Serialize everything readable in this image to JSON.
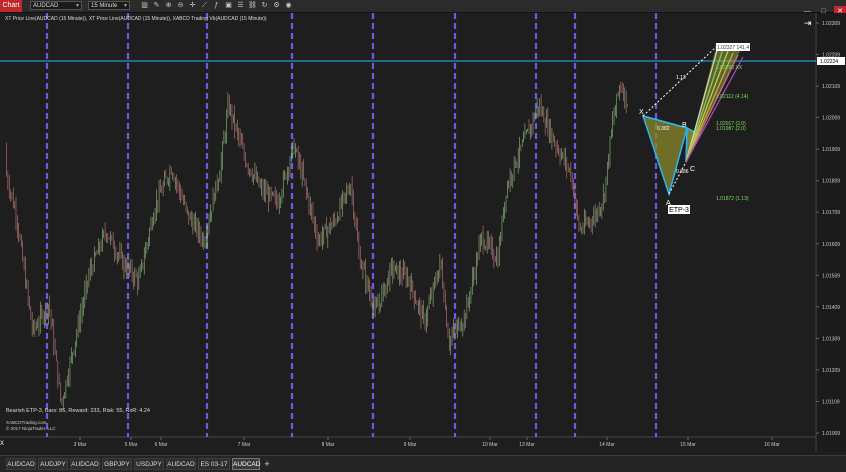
{
  "toolbar": {
    "chart_label": "Chart",
    "instrument": "AUDCAD",
    "interval": "15 Minute"
  },
  "indicator_line": "XT Price Line(AUDCAD (15 Minute)), XT Price Line(AUDCAD (15 Minute)), XABCD Trading Vb(AUDCAD (15 Minute))",
  "stats_line": "Bearish ETP-3, Bars: 86, Reward: 233, Risk: 55, RxR: 4.24",
  "site": "XABCDTrading.com",
  "copyright": "© 2017 NinjaTrader, LLC",
  "close_panel": "X",
  "pattern_labels": {
    "x": "X",
    "a": "A",
    "b": "B",
    "c": "C",
    "name": "ETP-3",
    "target_top": "1.02327 141.4",
    "lvl1": "1.02250 XX",
    "lvl2": "1.02112 (4.14)",
    "lvl3": "1.02017 (2.0)",
    "lvl4": "1.01987 (2.0)",
    "lvl5": "1.01872 (1.13)",
    "ratio1": "1.13",
    "ratio2": "0.382",
    "ratio3": "0.886"
  },
  "chart_data": {
    "type": "candlestick",
    "y_ticks": [
      "1.02309",
      "1.02209",
      "1.02109",
      "1.02009",
      "1.01909",
      "1.01809",
      "1.01709",
      "1.01609",
      "1.01509",
      "1.01409",
      "1.01309",
      "1.01209",
      "1.01109",
      "1.01009"
    ],
    "ylim": [
      1.01009,
      1.02309
    ],
    "current_price": "1.02224",
    "x_ticks": [
      "3 Mar",
      "5 Mar",
      "6 Mar",
      "7 Mar",
      "8 Mar",
      "9 Mar",
      "10 Mar",
      "13 Mar",
      "14 Mar",
      "15 Mar",
      "16 Mar"
    ],
    "session_separator_count": 18,
    "trend_path": [
      [
        0.0,
        1.0191
      ],
      [
        0.02,
        1.017
      ],
      [
        0.04,
        1.0133
      ],
      [
        0.06,
        1.0142
      ],
      [
        0.075,
        1.011
      ],
      [
        0.09,
        1.0128
      ],
      [
        0.11,
        1.0152
      ],
      [
        0.13,
        1.0165
      ],
      [
        0.15,
        1.0155
      ],
      [
        0.17,
        1.0149
      ],
      [
        0.19,
        1.0173
      ],
      [
        0.21,
        1.0185
      ],
      [
        0.23,
        1.017
      ],
      [
        0.25,
        1.0162
      ],
      [
        0.27,
        1.0185
      ],
      [
        0.28,
        1.0205
      ],
      [
        0.3,
        1.0188
      ],
      [
        0.32,
        1.0178
      ],
      [
        0.34,
        1.0174
      ],
      [
        0.36,
        1.0192
      ],
      [
        0.37,
        1.0183
      ],
      [
        0.39,
        1.0162
      ],
      [
        0.41,
        1.0168
      ],
      [
        0.43,
        1.018
      ],
      [
        0.44,
        1.0157
      ],
      [
        0.46,
        1.0139
      ],
      [
        0.48,
        1.0153
      ],
      [
        0.5,
        1.015
      ],
      [
        0.52,
        1.0136
      ],
      [
        0.54,
        1.0155
      ],
      [
        0.55,
        1.013
      ],
      [
        0.57,
        1.0138
      ],
      [
        0.59,
        1.0163
      ],
      [
        0.61,
        1.0156
      ],
      [
        0.62,
        1.0178
      ],
      [
        0.63,
        1.0186
      ],
      [
        0.65,
        1.0198
      ],
      [
        0.66,
        1.0205
      ],
      [
        0.68,
        1.0193
      ],
      [
        0.7,
        1.0183
      ],
      [
        0.71,
        1.0165
      ],
      [
        0.73,
        1.017
      ],
      [
        0.74,
        1.0176
      ],
      [
        0.75,
        1.0198
      ],
      [
        0.76,
        1.0212
      ],
      [
        0.77,
        1.0205
      ]
    ],
    "x_fraction_note": ""
  },
  "tabs": [
    "AUDCAD",
    "AUDJPY",
    "AUDCAD",
    "GBPJPY",
    "USDJPY",
    "AUDCAD",
    "ES 03-17",
    "AUDCAD"
  ],
  "active_tab": 7,
  "add_tab": "+",
  "colors": {
    "background": "#1e1e1e",
    "price_line": "#29b6f6",
    "session_separator": "#6b5be6",
    "candle_up": "#8fbf7f",
    "candle_down": "#c27c7c",
    "pattern_fill": "#8a8a2a",
    "target_text": "#7be05b"
  }
}
